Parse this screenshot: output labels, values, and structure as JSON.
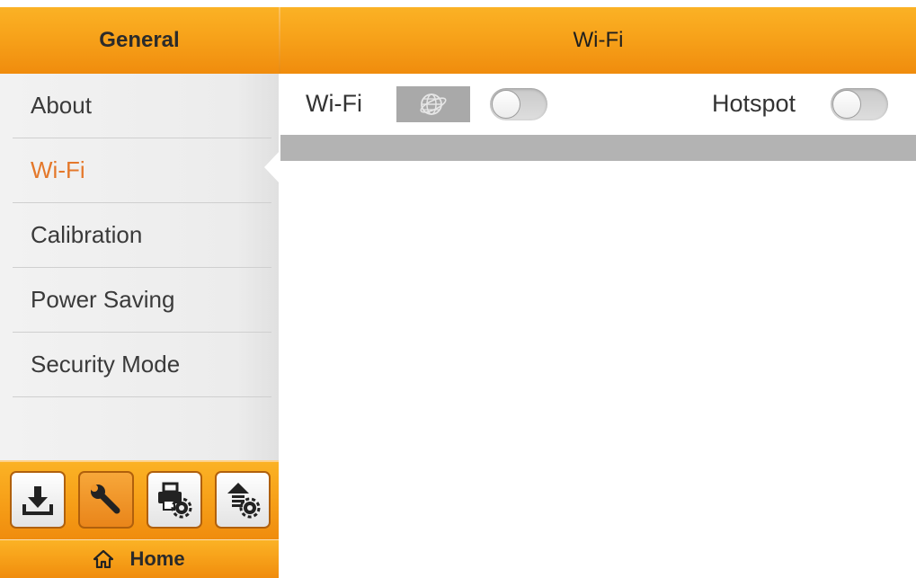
{
  "header": {
    "left_title": "General",
    "right_title": "Wi-Fi"
  },
  "sidebar": {
    "items": [
      {
        "label": "About",
        "active": false
      },
      {
        "label": "Wi-Fi",
        "active": true
      },
      {
        "label": "Calibration",
        "active": false
      },
      {
        "label": "Power Saving",
        "active": false
      },
      {
        "label": "Security Mode",
        "active": false
      }
    ]
  },
  "toolbar": {
    "buttons": [
      {
        "icon": "download-icon",
        "active": false
      },
      {
        "icon": "wrench-icon",
        "active": true
      },
      {
        "icon": "printer-settings-icon",
        "active": false
      },
      {
        "icon": "upload-settings-icon",
        "active": false
      }
    ]
  },
  "home": {
    "label": "Home",
    "icon": "home-icon"
  },
  "wifi_panel": {
    "wifi_label": "Wi-Fi",
    "wifi_icon": "globe-icon",
    "wifi_enabled": false,
    "hotspot_label": "Hotspot",
    "hotspot_enabled": false
  },
  "colors": {
    "accent_orange": "#f7a21a",
    "active_text": "#e4782b",
    "strip_gray": "#b3b3b3"
  }
}
